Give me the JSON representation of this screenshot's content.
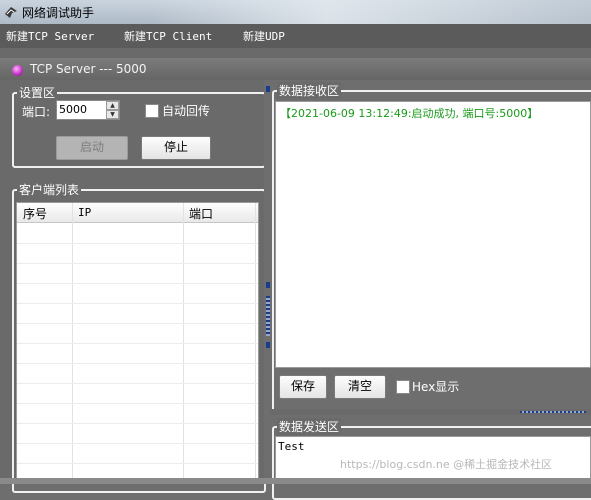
{
  "window": {
    "title": "网络调试助手"
  },
  "menu": {
    "items": [
      {
        "label": "新建TCP Server"
      },
      {
        "label": "新建TCP Client"
      },
      {
        "label": "新建UDP"
      }
    ]
  },
  "tcp_window": {
    "title": "TCP Server --- 5000"
  },
  "settings": {
    "group_title": "设置区",
    "port_label": "端口:",
    "port_value": "5000",
    "auto_reply_label": "自动回传",
    "auto_reply_checked": false,
    "start_label": "启动",
    "stop_label": "停止"
  },
  "clients": {
    "group_title": "客户端列表",
    "columns": [
      "序号",
      "IP",
      "端口"
    ],
    "rows": []
  },
  "receive": {
    "group_title": "数据接收区",
    "log": "【2021-06-09 13:12:49:启动成功, 端口号:5000】",
    "log_color": "#1a9a1a",
    "save_label": "保存",
    "clear_label": "清空",
    "hex_label": "Hex显示",
    "hex_checked": false
  },
  "send": {
    "group_title": "数据发送区",
    "text": "Test"
  },
  "watermark": "https://blog.csdn.ne @稀土掘金技术社区"
}
